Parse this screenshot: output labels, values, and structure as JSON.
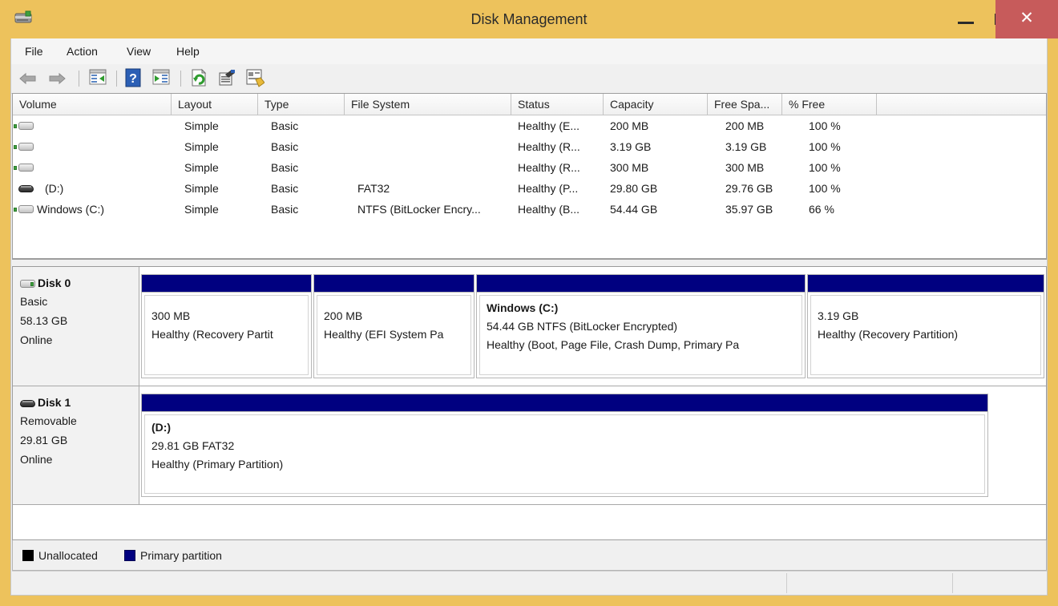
{
  "window": {
    "title": "Disk Management",
    "icon": "disk-management-icon",
    "controls": {
      "minimize": "–",
      "maximize": "□",
      "close": "✕"
    }
  },
  "menubar": {
    "items": [
      {
        "label": "File",
        "name": "menu-file"
      },
      {
        "label": "Action",
        "name": "menu-action"
      },
      {
        "label": "View",
        "name": "menu-view"
      },
      {
        "label": "Help",
        "name": "menu-help"
      }
    ]
  },
  "toolbar": {
    "buttons": [
      {
        "name": "back-arrow-icon",
        "title": "Back"
      },
      {
        "name": "forward-arrow-icon",
        "title": "Forward"
      },
      {
        "name": "show-hide-tree-icon",
        "title": "Show/Hide Console Tree"
      },
      {
        "name": "help-icon",
        "title": "Help"
      },
      {
        "name": "show-action-pane-icon",
        "title": "Show/Hide Action Pane"
      },
      {
        "name": "refresh-icon",
        "title": "Refresh"
      },
      {
        "name": "properties-icon",
        "title": "Properties"
      },
      {
        "name": "rescan-disks-icon",
        "title": "Rescan Disks"
      }
    ]
  },
  "volume_list": {
    "columns": [
      {
        "label": "Volume",
        "name": "column-volume"
      },
      {
        "label": "Layout",
        "name": "column-layout"
      },
      {
        "label": "Type",
        "name": "column-type"
      },
      {
        "label": "File System",
        "name": "column-file-system"
      },
      {
        "label": "Status",
        "name": "column-status"
      },
      {
        "label": "Capacity",
        "name": "column-capacity"
      },
      {
        "label": "Free Spa...",
        "name": "column-free-space"
      },
      {
        "label": "% Free",
        "name": "column-percent-free"
      },
      {
        "label": "",
        "name": "column-filler"
      }
    ],
    "rows": [
      {
        "icon": "hard-disk-volume-icon",
        "volume": "",
        "layout": "Simple",
        "type": "Basic",
        "file_system": "",
        "status": "Healthy (E...",
        "capacity": "200 MB",
        "free_space": "200 MB",
        "percent_free": "100 %"
      },
      {
        "icon": "hard-disk-volume-icon",
        "volume": "",
        "layout": "Simple",
        "type": "Basic",
        "file_system": "",
        "status": "Healthy (R...",
        "capacity": "3.19 GB",
        "free_space": "3.19 GB",
        "percent_free": "100 %"
      },
      {
        "icon": "hard-disk-volume-icon",
        "volume": "",
        "layout": "Simple",
        "type": "Basic",
        "file_system": "",
        "status": "Healthy (R...",
        "capacity": "300 MB",
        "free_space": "300 MB",
        "percent_free": "100 %"
      },
      {
        "icon": "removable-drive-icon",
        "volume": "(D:)",
        "layout": "Simple",
        "type": "Basic",
        "file_system": "FAT32",
        "status": "Healthy (P...",
        "capacity": "29.80 GB",
        "free_space": "29.76 GB",
        "percent_free": "100 %"
      },
      {
        "icon": "hard-disk-volume-icon",
        "volume": "Windows (C:)",
        "layout": "Simple",
        "type": "Basic",
        "file_system": "NTFS (BitLocker Encry...",
        "status": "Healthy (B...",
        "capacity": "54.44 GB",
        "free_space": "35.97 GB",
        "percent_free": "66 %"
      }
    ]
  },
  "disks": [
    {
      "name": "disk-0",
      "icon": "hard-disk-icon",
      "title": "Disk 0",
      "type": "Basic",
      "size": "58.13 GB",
      "state": "Online",
      "partitions": [
        {
          "name": "partition-recovery-300mb",
          "label": "",
          "size_line": "300 MB",
          "status_line": "Healthy (Recovery Partit",
          "bar_color": "#000080"
        },
        {
          "name": "partition-efi-200mb",
          "label": "",
          "size_line": "200 MB",
          "status_line": "Healthy (EFI System Pa",
          "bar_color": "#000080"
        },
        {
          "name": "partition-windows-c",
          "label": "Windows  (C:)",
          "size_line": "54.44 GB NTFS (BitLocker Encrypted)",
          "status_line": "Healthy (Boot, Page File, Crash Dump, Primary Pa",
          "bar_color": "#000080"
        },
        {
          "name": "partition-recovery-3gb",
          "label": "",
          "size_line": "3.19 GB",
          "status_line": "Healthy (Recovery Partition)",
          "bar_color": "#000080"
        }
      ]
    },
    {
      "name": "disk-1",
      "icon": "removable-drive-icon",
      "title": "Disk 1",
      "type": "Removable",
      "size": "29.81 GB",
      "state": "Online",
      "partitions": [
        {
          "name": "partition-d-fat32",
          "label": " (D:)",
          "size_line": "29.81 GB FAT32",
          "status_line": "Healthy (Primary Partition)",
          "bar_color": "#000080"
        }
      ]
    }
  ],
  "legend": [
    {
      "name": "legend-unallocated",
      "label": "Unallocated",
      "color": "#000000"
    },
    {
      "name": "legend-primary-partition",
      "label": "Primary partition",
      "color": "#000080"
    }
  ],
  "statusbar": {
    "segments": [
      "",
      "",
      ""
    ]
  }
}
